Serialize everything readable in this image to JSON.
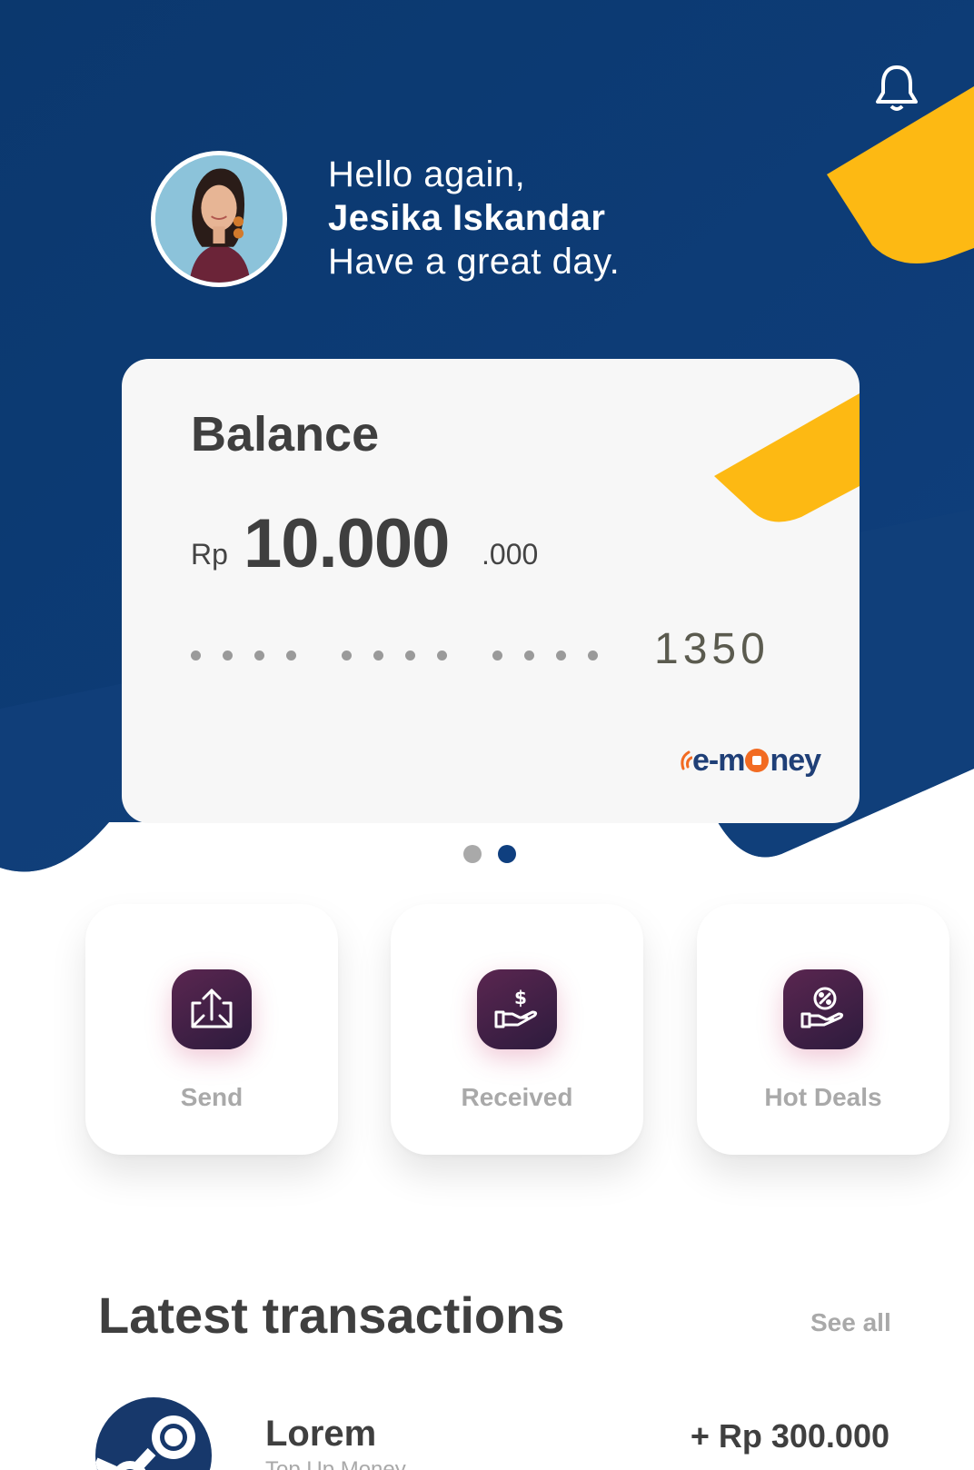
{
  "header": {
    "greeting_line1": "Hello again,",
    "user_name": "Jesika Iskandar",
    "greeting_line3": "Have a great day.",
    "notification_icon": "bell-icon"
  },
  "card": {
    "title": "Balance",
    "currency": "Rp",
    "amount": "10.000",
    "decimals": ".000",
    "last_digits": "1350",
    "brand_left": "e-m",
    "brand_right": "ney",
    "page_indicator": {
      "count": 2,
      "active": 2
    }
  },
  "actions": [
    {
      "label": "Send",
      "icon": "send-icon"
    },
    {
      "label": "Received",
      "icon": "receive-money-icon"
    },
    {
      "label": "Hot Deals",
      "icon": "deal-icon"
    }
  ],
  "transactions": {
    "title": "Latest transactions",
    "see_all": "See all",
    "items": [
      {
        "name": "Lorem",
        "subtitle": "Top Up Money",
        "amount": "+ Rp 300.000",
        "icon": "steam-icon"
      }
    ]
  },
  "colors": {
    "navy": "#0d3b73",
    "yellow": "#fdb913",
    "card_bg": "#f7f7f7",
    "action_icon": "#3b1f45",
    "text_dark": "#3f3f3f",
    "text_muted": "#a9a9a9"
  }
}
